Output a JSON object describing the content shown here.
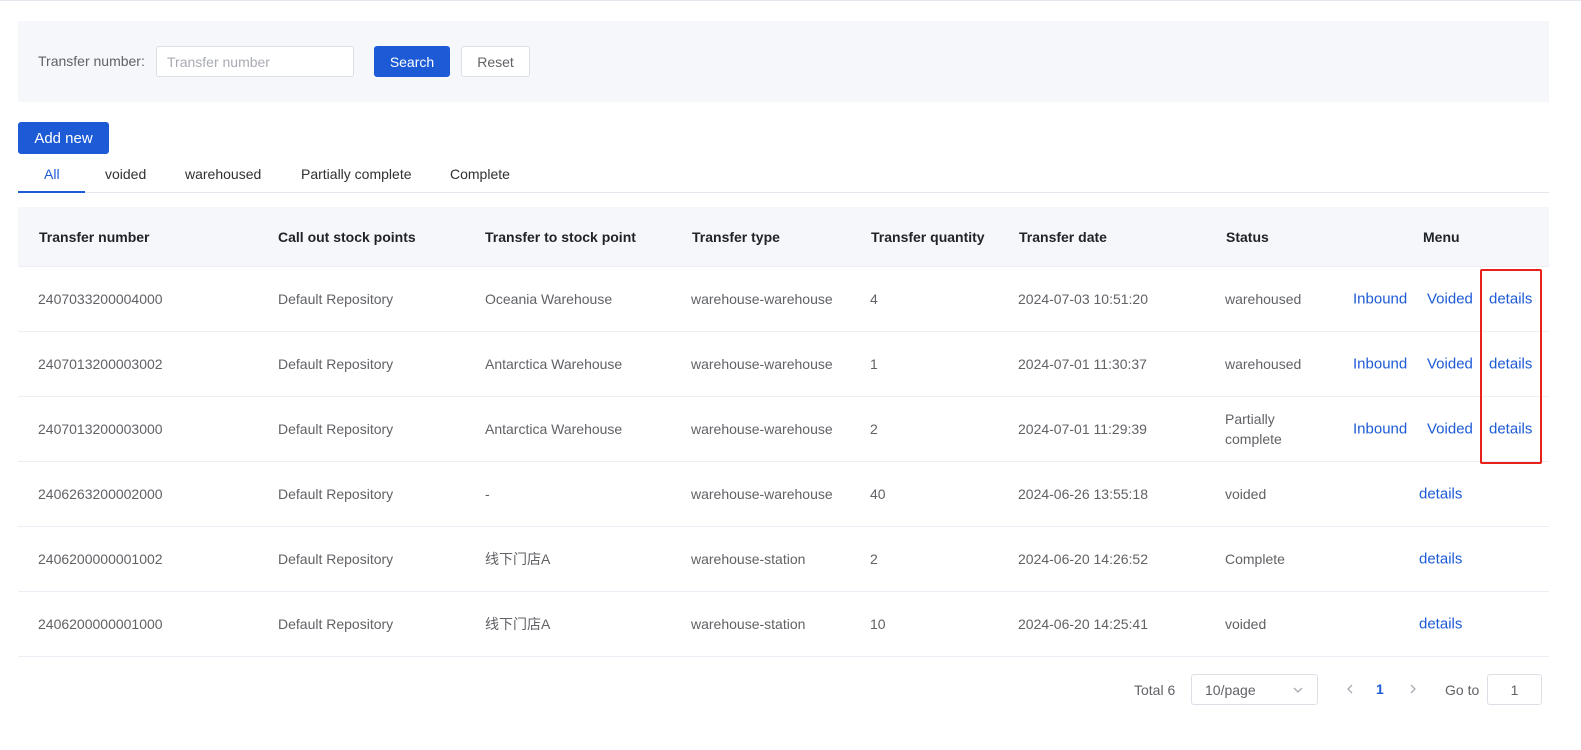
{
  "search": {
    "label": "Transfer number:",
    "placeholder": "Transfer number",
    "value": "",
    "search_button": "Search",
    "reset_button": "Reset"
  },
  "toolbar": {
    "add_button": "Add new"
  },
  "tabs": [
    {
      "label": "All",
      "active": true
    },
    {
      "label": "voided",
      "active": false
    },
    {
      "label": "warehoused",
      "active": false
    },
    {
      "label": "Partially complete",
      "active": false
    },
    {
      "label": "Complete",
      "active": false
    }
  ],
  "table": {
    "columns": [
      "Transfer number",
      "Call out stock points",
      "Transfer to stock point",
      "Transfer type",
      "Transfer quantity",
      "Transfer date",
      "Status",
      "Menu"
    ],
    "rows": [
      {
        "number": "2407033200004000",
        "from": "Default Repository",
        "to": "Oceania Warehouse",
        "type": "warehouse-warehouse",
        "qty": "4",
        "date": "2024-07-03 10:51:20",
        "status": "warehoused",
        "actions": [
          "Inbound",
          "Voided",
          "details"
        ]
      },
      {
        "number": "2407013200003002",
        "from": "Default Repository",
        "to": "Antarctica Warehouse",
        "type": "warehouse-warehouse",
        "qty": "1",
        "date": "2024-07-01 11:30:37",
        "status": "warehoused",
        "actions": [
          "Inbound",
          "Voided",
          "details"
        ]
      },
      {
        "number": "2407013200003000",
        "from": "Default Repository",
        "to": "Antarctica Warehouse",
        "type": "warehouse-warehouse",
        "qty": "2",
        "date": "2024-07-01 11:29:39",
        "status": "Partially complete",
        "actions": [
          "Inbound",
          "Voided",
          "details"
        ]
      },
      {
        "number": "2406263200002000",
        "from": "Default Repository",
        "to": "-",
        "type": "warehouse-warehouse",
        "qty": "40",
        "date": "2024-06-26 13:55:18",
        "status": "voided",
        "actions": [
          "details"
        ]
      },
      {
        "number": "2406200000001002",
        "from": "Default Repository",
        "to": "线下门店A",
        "type": "warehouse-station",
        "qty": "2",
        "date": "2024-06-20 14:26:52",
        "status": "Complete",
        "actions": [
          "details"
        ]
      },
      {
        "number": "2406200000001000",
        "from": "Default Repository",
        "to": "线下门店A",
        "type": "warehouse-station",
        "qty": "10",
        "date": "2024-06-20 14:25:41",
        "status": "voided",
        "actions": [
          "details"
        ]
      }
    ]
  },
  "pagination": {
    "total": "Total 6",
    "page_size": "10/page",
    "current_page": "1",
    "goto_label": "Go to",
    "goto_value": "1"
  },
  "colors": {
    "primary": "#1d5bd6",
    "highlight": "#e8221b",
    "panel_bg": "#f5f7fa"
  }
}
